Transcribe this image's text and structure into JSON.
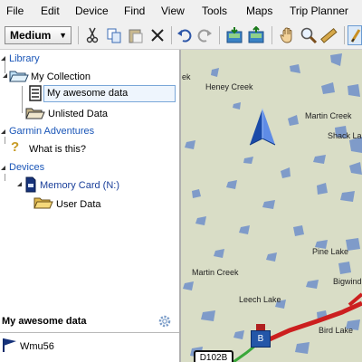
{
  "menu": [
    "File",
    "Edit",
    "Device",
    "Find",
    "View",
    "Tools",
    "Maps",
    "Trip Planner"
  ],
  "toolbar": {
    "detail_level": "Medium",
    "icons": [
      "cut-icon",
      "copy-icon",
      "paste-icon",
      "delete-icon",
      "undo-icon",
      "redo-icon",
      "receive-from-device-icon",
      "send-to-device-icon",
      "hand-tool-icon",
      "zoom-tool-icon",
      "measure-tool-icon",
      "select-tool-icon"
    ]
  },
  "tree": {
    "library": "Library",
    "my_collection": "My Collection",
    "my_awesome_data": "My awesome data",
    "unlisted_data": "Unlisted Data",
    "garmin_adventures": "Garmin Adventures",
    "what_is_this": "What is this?",
    "devices": "Devices",
    "memory_card": "Memory Card (N:)",
    "user_data": "User Data"
  },
  "details": {
    "title": "My awesome data",
    "first_item": "Wmu56"
  },
  "map": {
    "labels": [
      "Heney Creek",
      "Martin Creek",
      "Shack La",
      "Martin Creek",
      "Pine Lake",
      "Leech Lake",
      "Bigwind",
      "Bird Lake"
    ],
    "route_marker": "B",
    "road_label": "D102B",
    "top_left_fragment": "ek"
  },
  "colors": {
    "map_land": "#d9ddc6",
    "water": "#7f9bc9",
    "route": "#cc1f1f",
    "tree_header": "#1a56b8"
  }
}
